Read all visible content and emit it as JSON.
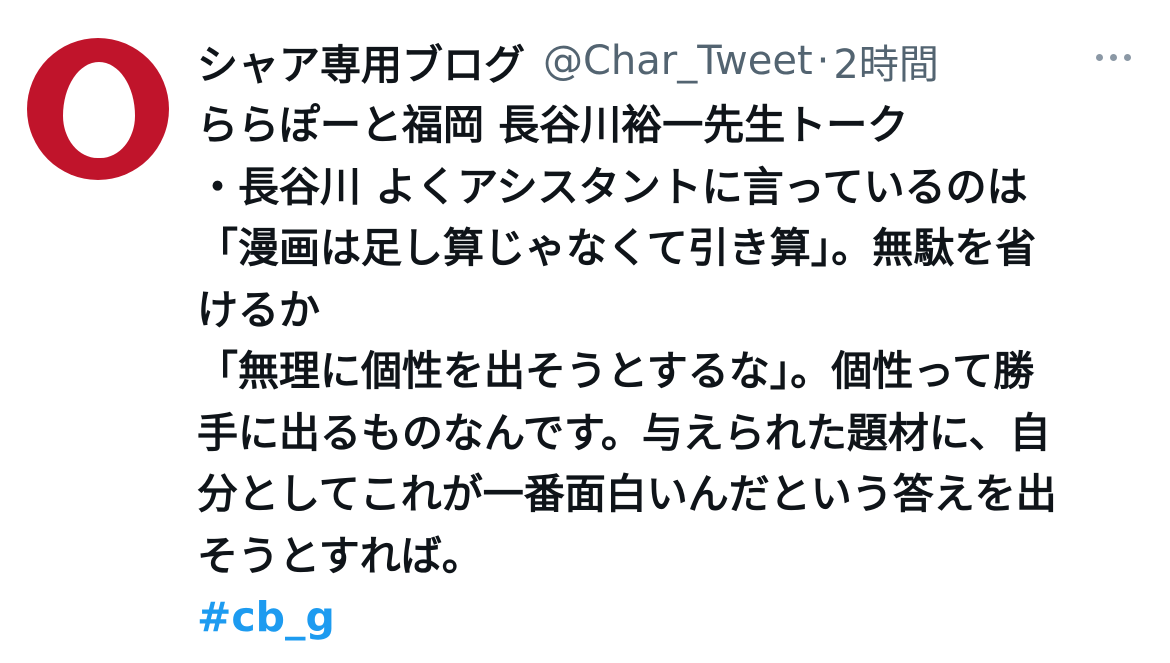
{
  "tweet": {
    "author": {
      "display_name": "シャア専用ブログ",
      "handle": "@Char_Tweet",
      "avatar_icon": "egg-avatar-icon",
      "avatar_color": "#c0142b"
    },
    "separator": "·",
    "timestamp": "2時間",
    "more_icon": "more-options-icon",
    "lines": [
      "ららぽーと福岡 長谷川裕一先生トーク",
      "・長谷川 よくアシスタントに言っているのは",
      "「漫画は足し算じゃなくて引き算」。無駄を省",
      "けるか",
      "「無理に個性を出そうとするな」。個性って勝",
      "手に出るものなんです。与えられた題材に、自",
      "分としてこれが一番面白いんだという答えを出",
      "そうとすれば。"
    ],
    "hashtag": "#cb_g",
    "colors": {
      "text": "#0f1419",
      "secondary": "#536471",
      "link": "#1d9bf0"
    }
  }
}
